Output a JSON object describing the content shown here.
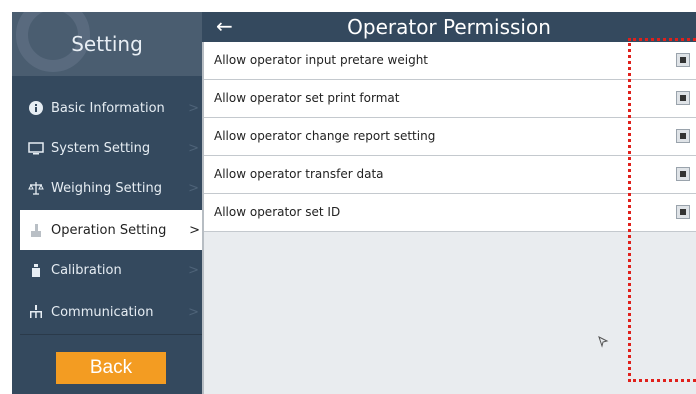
{
  "sidebar": {
    "title": "Setting",
    "items": [
      {
        "label": "Basic Information",
        "icon": "info-icon"
      },
      {
        "label": "System Setting",
        "icon": "monitor-icon"
      },
      {
        "label": "Weighing Setting",
        "icon": "scale-icon"
      },
      {
        "label": "Operation Setting",
        "icon": "hand-icon",
        "active": true
      },
      {
        "label": "Calibration",
        "icon": "weight-icon"
      },
      {
        "label": "Communication",
        "icon": "network-icon"
      }
    ],
    "chevron": ">",
    "back_label": "Back"
  },
  "header": {
    "back_arrow": "←",
    "title": "Operator Permission"
  },
  "permissions": [
    {
      "label": "Allow operator input pretare weight",
      "checked": true
    },
    {
      "label": "Allow operator set print format",
      "checked": true
    },
    {
      "label": "Allow operator change report setting",
      "checked": true
    },
    {
      "label": "Allow operator transfer data",
      "checked": true
    },
    {
      "label": "Allow operator set ID",
      "checked": true
    }
  ],
  "colors": {
    "accent": "#f39c22",
    "sidebar_bg": "#34495e",
    "highlight": "#e0201b"
  }
}
